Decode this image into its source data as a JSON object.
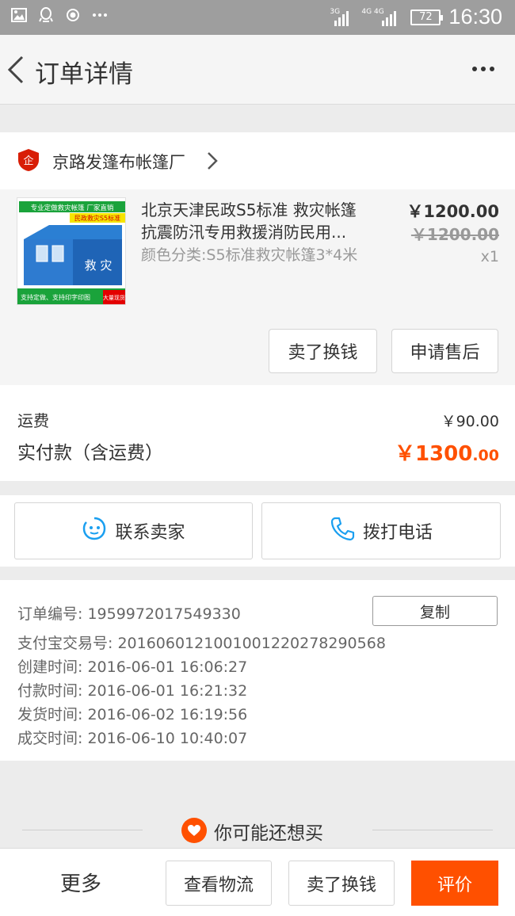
{
  "status_bar": {
    "icons": [
      "image-icon",
      "qq-icon",
      "record-icon",
      "ellipsis-icon"
    ],
    "sim1": "3G",
    "sim2": "4G 4G",
    "battery": "72",
    "time": "16:30"
  },
  "nav": {
    "title": "订单详情",
    "back_icon": "back-icon",
    "more_icon": "more-icon"
  },
  "shop": {
    "name": "京路发篷布帐篷厂",
    "badge": "企"
  },
  "product": {
    "title_line1": "北京天津民政S5标准 救灾帐篷",
    "title_line2": "抗震防汛专用救援消防民用...",
    "sku": "颜色分类:S5标准救灾帐篷3*4米",
    "price": "￥1200.00",
    "original_price": "￥1200.00",
    "quantity": "x1",
    "image": {
      "banner": "专业定做救灾帐篷 厂家直销",
      "sub_banner": "民政救灾S5标准",
      "side_text": "救 灾",
      "footer": "支持定做、支持印字印图",
      "tag": "大量现货"
    },
    "btn_sell": "卖了换钱",
    "btn_aftersale": "申请售后"
  },
  "totals": {
    "shipping_label": "运费",
    "shipping_value": "￥90.00",
    "paid_label": "实付款（含运费）",
    "paid_int": "￥1300",
    "paid_dec": ".00",
    "accent_color": "#ff5000"
  },
  "contact": {
    "seller": "联系卖家",
    "call": "拨打电话"
  },
  "order_info": {
    "order_no": "订单编号: 1959972017549330",
    "copy": "复制",
    "alipay_no": "支付宝交易号: 2016060121001001220278290568",
    "created": "创建时间: 2016-06-01 16:06:27",
    "paid": "付款时间: 2016-06-01 16:21:32",
    "shipped": "发货时间: 2016-06-02 16:19:56",
    "completed": "成交时间: 2016-06-10 10:40:07"
  },
  "recommend": {
    "text": "你可能还想买"
  },
  "bottom_bar": {
    "more": "更多",
    "logistics": "查看物流",
    "sell": "卖了换钱",
    "rate": "评价"
  }
}
